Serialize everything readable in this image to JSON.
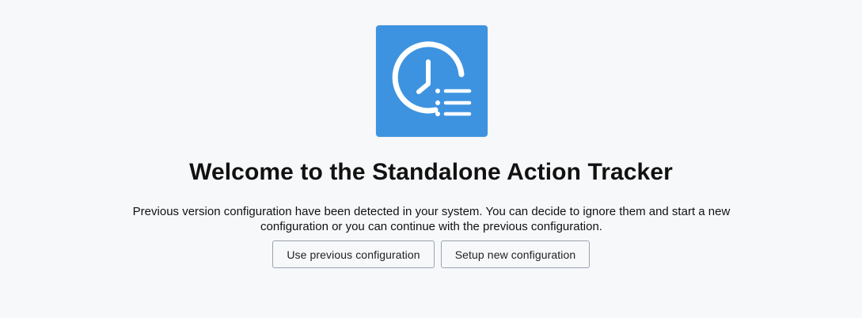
{
  "logo": {
    "icon": "clock-list-icon",
    "background_color": "#3d93e0",
    "foreground_color": "#ffffff"
  },
  "welcome": {
    "title": "Welcome to the Standalone Action Tracker",
    "message": "Previous version configuration have been detected in your system. You can decide to ignore them and start a new configuration or you can continue with the previous configuration."
  },
  "actions": {
    "use_previous_label": "Use previous configuration",
    "setup_new_label": "Setup new configuration"
  }
}
